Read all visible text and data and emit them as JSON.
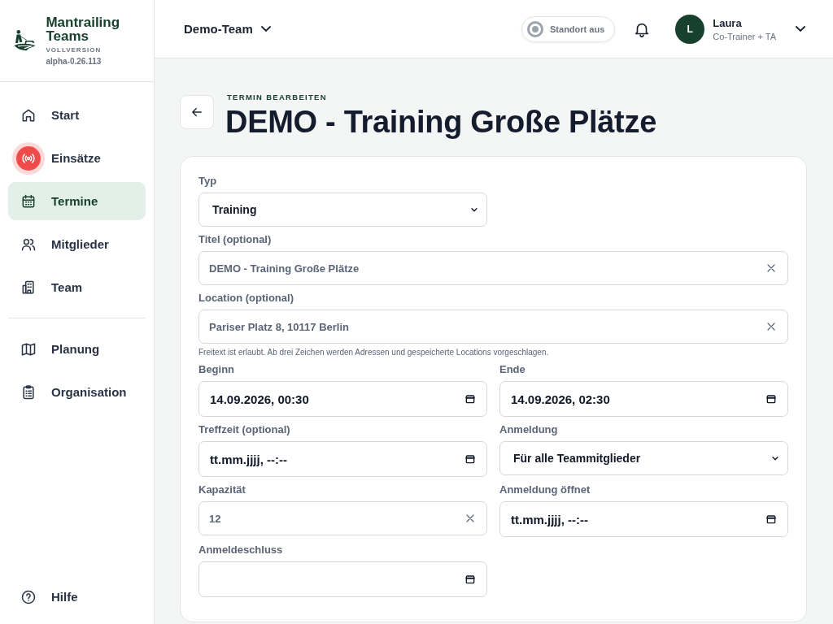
{
  "brand": {
    "name": "Mantrailing Teams",
    "edition": "VOLLVERSION",
    "version": "alpha-0.26.113"
  },
  "nav": [
    {
      "label": "Start",
      "selected": false
    },
    {
      "label": "Einsätze",
      "selected": false
    },
    {
      "label": "Termine",
      "selected": true
    },
    {
      "label": "Mitglieder",
      "selected": false
    },
    {
      "label": "Team",
      "selected": false
    }
  ],
  "nav_secondary": [
    {
      "label": "Planung",
      "selected": false
    },
    {
      "label": "Organisation",
      "selected": false
    }
  ],
  "help": "Hilfe",
  "header": {
    "team": "Demo-Team",
    "location_toggle": {
      "label": "Standort aus",
      "on": false
    },
    "user": {
      "initial": "L",
      "name": "Laura",
      "role": "Co-Trainer + TA"
    }
  },
  "page": {
    "eyebrow": "TERMIN BEARBEITEN",
    "title": "DEMO - Training Große Plätze"
  },
  "form": [
    [
      {
        "kind": "select",
        "label": "Typ",
        "value": "Training",
        "half": true
      }
    ],
    [
      {
        "kind": "text",
        "label": "Titel (optional)",
        "value": "DEMO - Training Große Plätze"
      }
    ],
    [
      {
        "kind": "text",
        "label": "Location (optional)",
        "value": "Pariser Platz 8, 10117 Berlin",
        "hint": "Freitext ist erlaubt. Ab drei Zeichen werden Adressen und gespeicherte Locations vorgeschlagen."
      }
    ],
    [
      {
        "kind": "datetime",
        "label": "Beginn",
        "value": "14.09.2026, 00:30"
      },
      {
        "kind": "datetime",
        "label": "Ende",
        "value": "14.09.2026, 02:30"
      }
    ],
    [
      {
        "kind": "datetime",
        "label": "Treffzeit (optional)",
        "value": "tt.mm.jjjj, --:--"
      },
      {
        "kind": "select",
        "label": "Anmeldung",
        "value": "Für alle Teammitglieder"
      }
    ],
    [
      {
        "kind": "text",
        "label": "Kapazität",
        "value": "12"
      },
      {
        "kind": "datetime",
        "label": "Anmeldung öffnet",
        "value": "tt.mm.jjjj, --:--"
      }
    ],
    [
      {
        "kind": "datetime",
        "label": "Anmeldeschluss",
        "half": true
      }
    ]
  ]
}
